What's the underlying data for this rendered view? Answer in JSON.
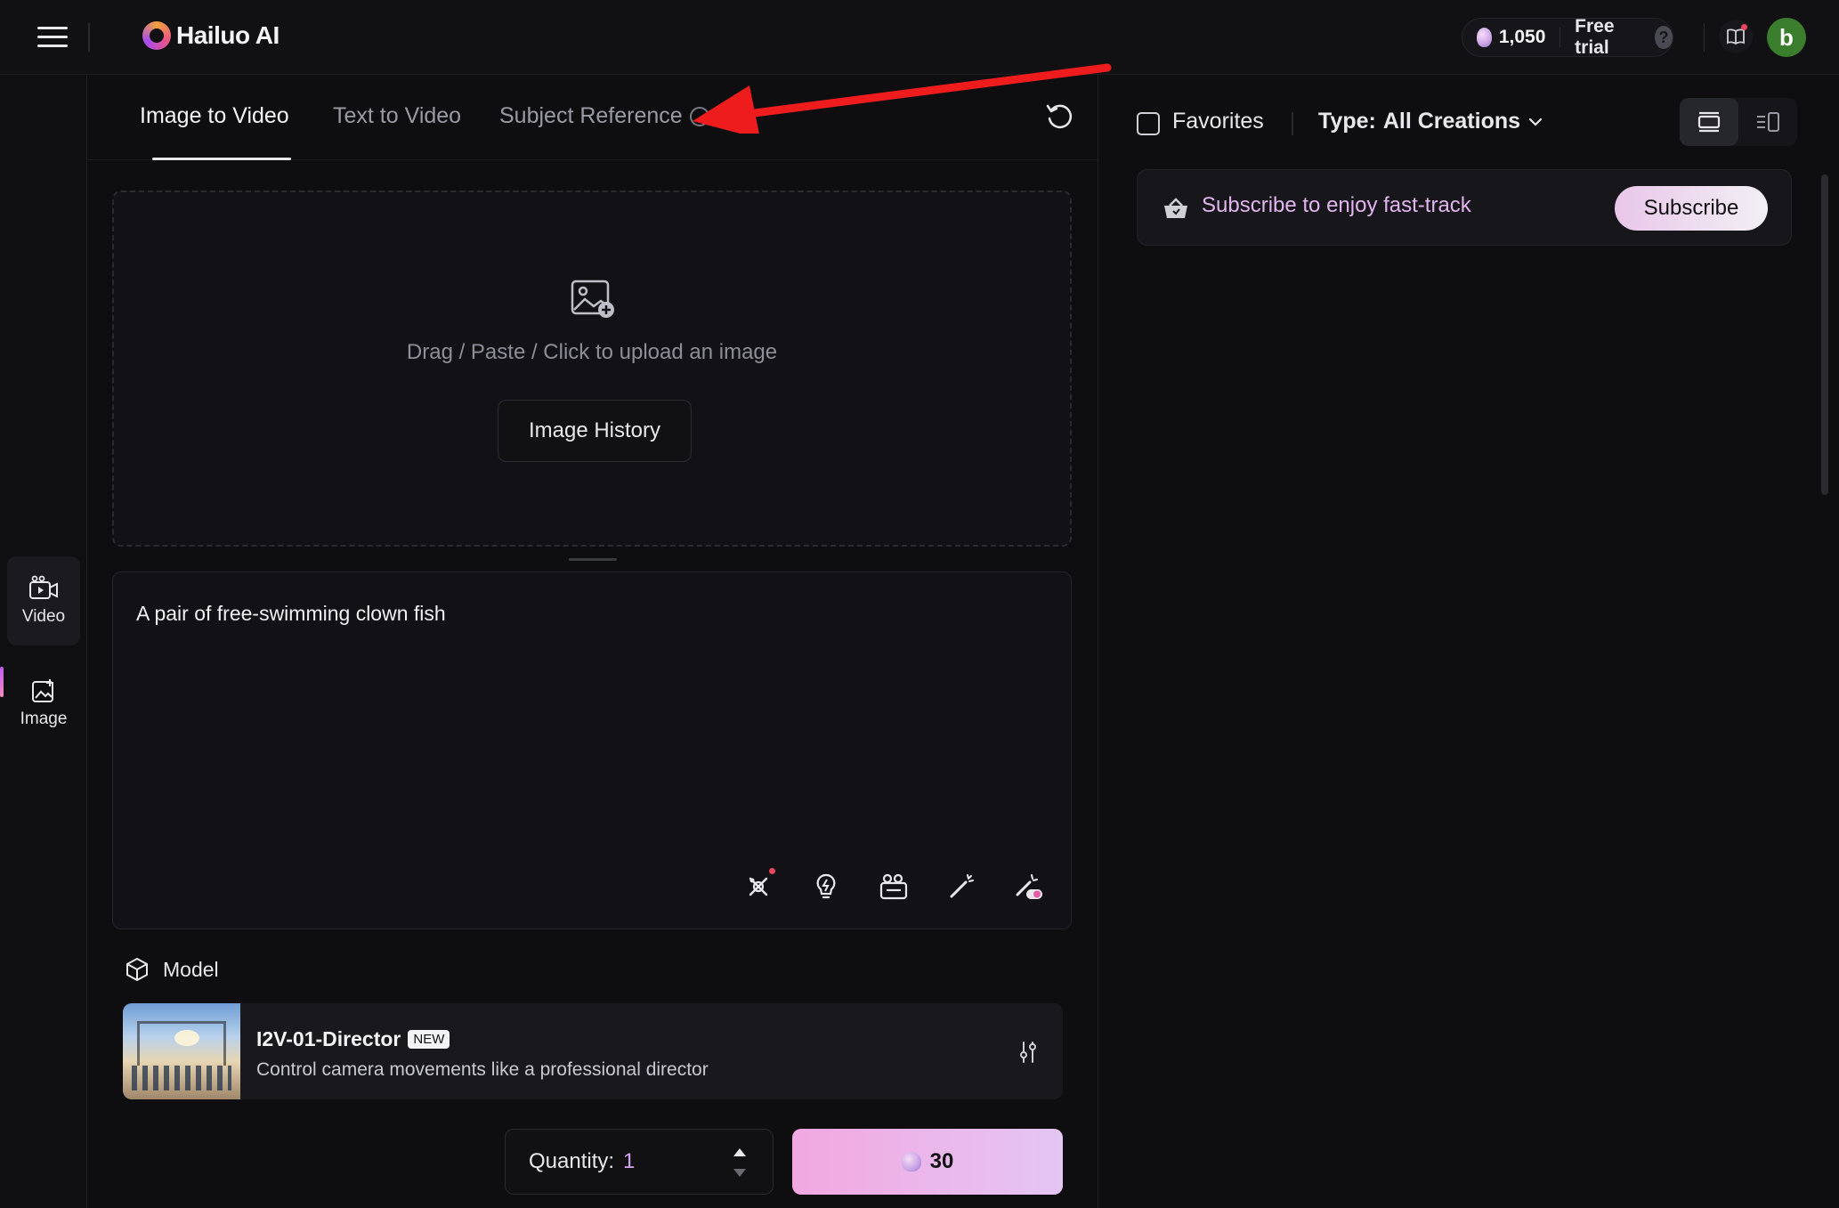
{
  "app": {
    "logo_text": "Hailuo AI"
  },
  "header": {
    "credits": "1,050",
    "free_trial": "Free trial",
    "help": "?",
    "avatar_letter": "b"
  },
  "rail": {
    "items": [
      {
        "label": "Video",
        "icon": "video-icon",
        "active": true
      },
      {
        "label": "Image",
        "icon": "image-icon",
        "active": false
      }
    ]
  },
  "tabs": [
    {
      "label": "Image to Video",
      "active": true
    },
    {
      "label": "Text to Video",
      "active": false
    },
    {
      "label": "Subject Reference",
      "active": false
    }
  ],
  "upload": {
    "instruction": "Drag / Paste / Click to upload an image",
    "history_label": "Image History"
  },
  "prompt": {
    "value": "A pair of free-swimming clown fish",
    "tools": [
      "sparkle-agent-icon",
      "lightbulb-icon",
      "camera-movement-icon",
      "magic-wand-icon",
      "auto-enhance-toggle-icon"
    ]
  },
  "model": {
    "heading": "Model",
    "name": "I2V-01-Director",
    "badge": "NEW",
    "description": "Control camera movements like a professional director"
  },
  "generate": {
    "quantity_label": "Quantity:",
    "quantity_value": "1",
    "cost": "30"
  },
  "right": {
    "favorites_label": "Favorites",
    "type_label": "Type:",
    "type_value": "All Creations",
    "banner_text": "Subscribe to enjoy fast-track",
    "subscribe_label": "Subscribe"
  },
  "colors": {
    "accent": "#e4c6f3",
    "annotation": "#ee1c1c",
    "avatar": "#3a7d2c"
  }
}
